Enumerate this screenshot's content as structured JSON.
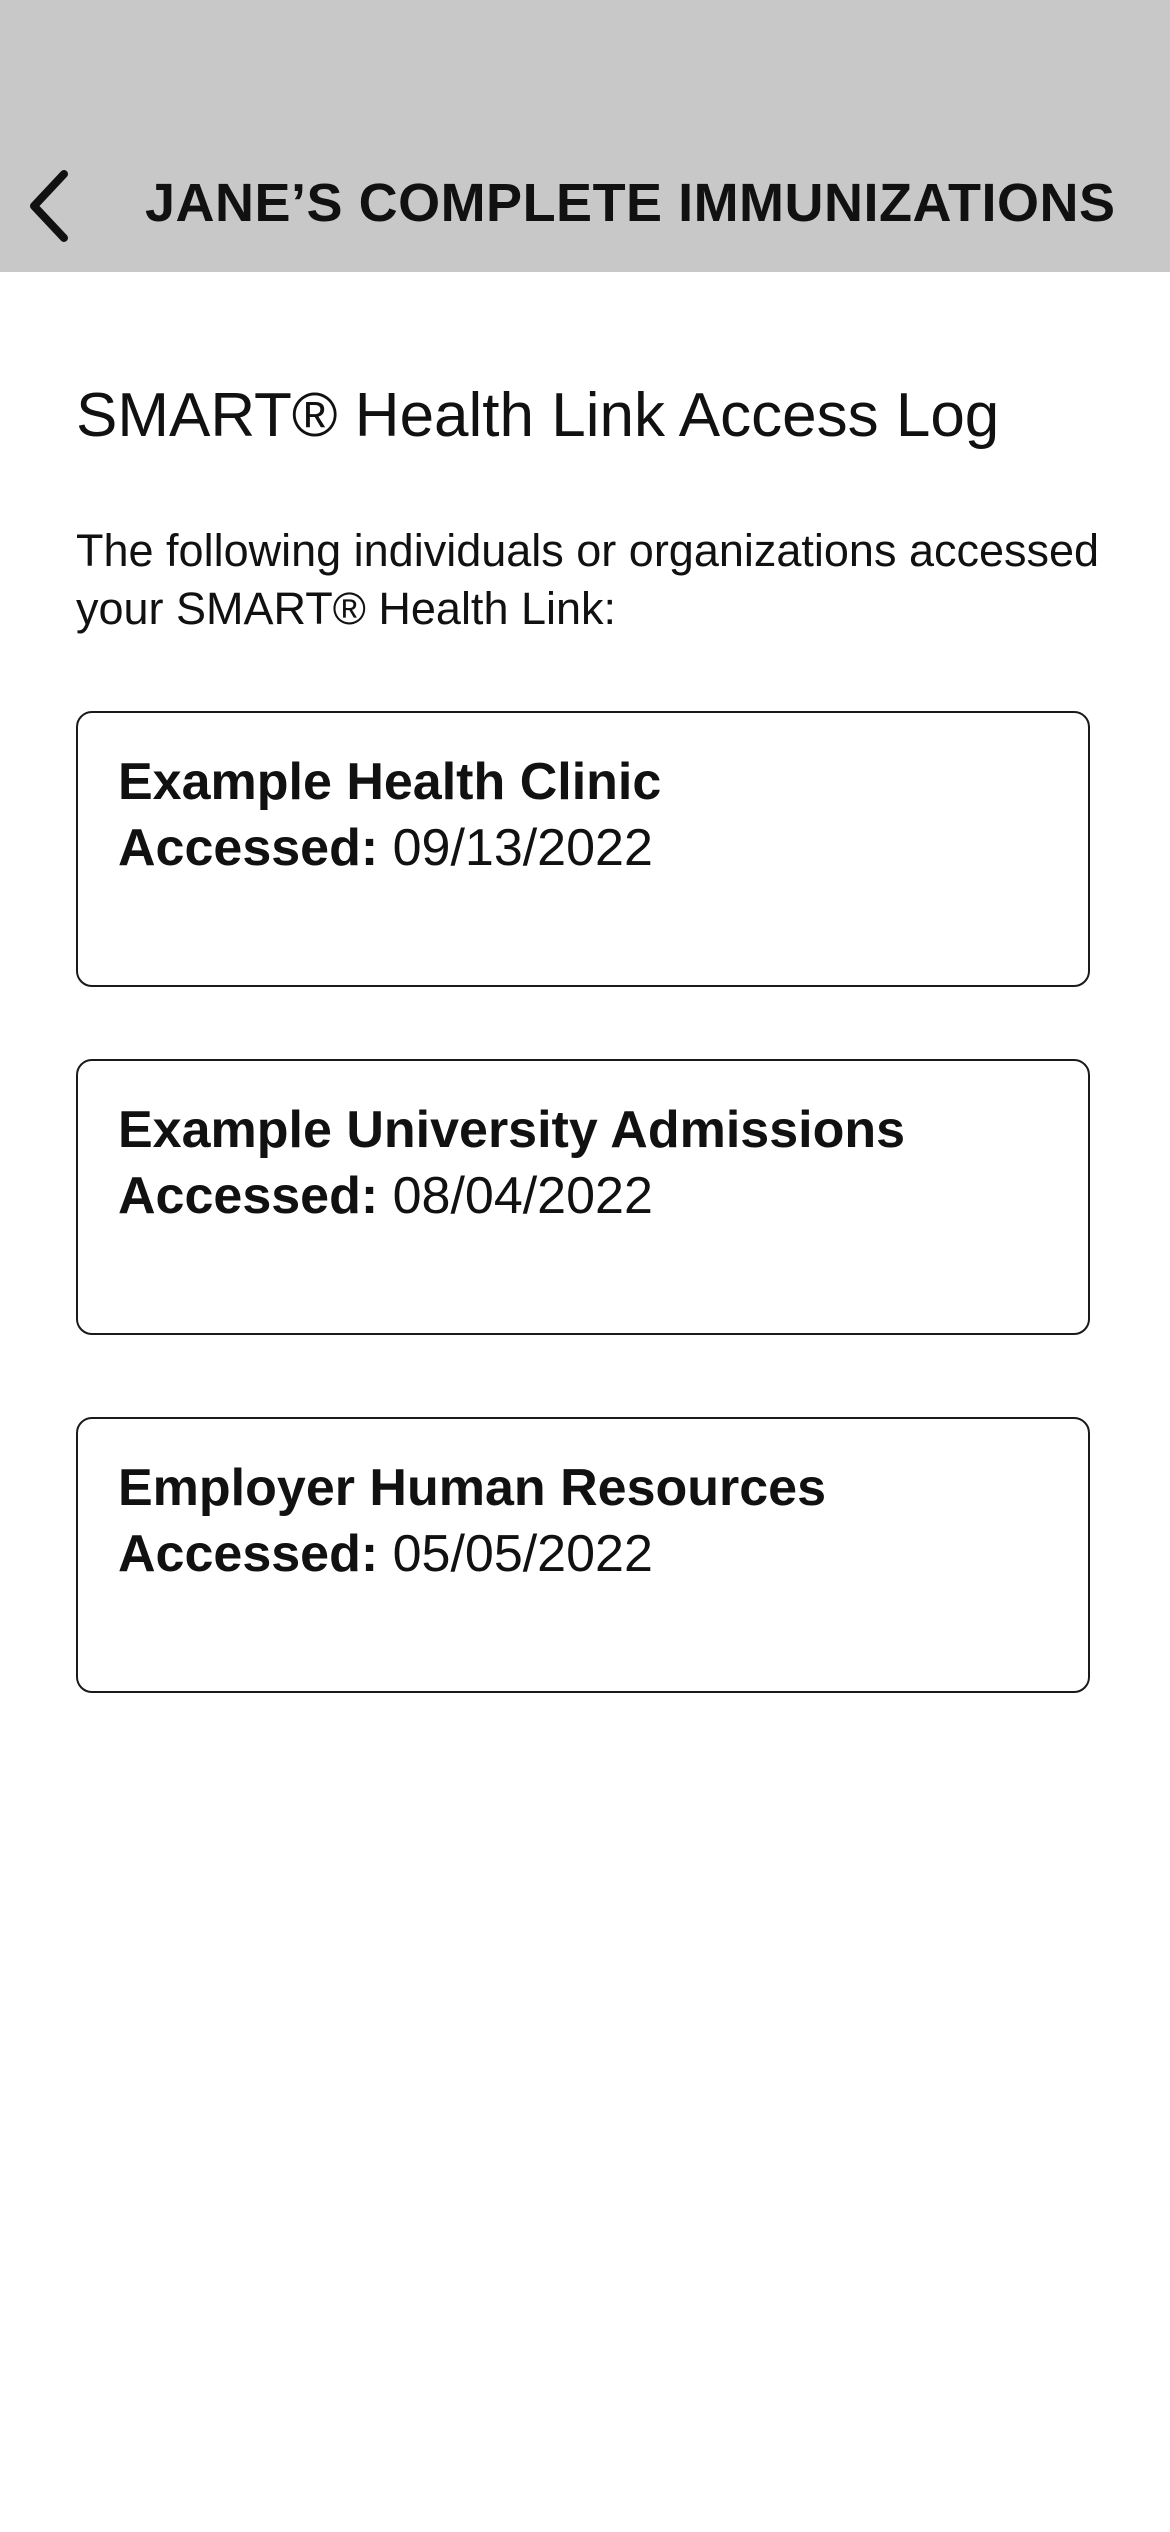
{
  "header": {
    "title": "JANE’S COMPLETE IMMUNIZATIONS",
    "back_icon": "chevron-left-icon"
  },
  "main": {
    "title": "SMART® Health Link Access Log",
    "intro": "The following individuals or organizations accessed your SMART® Health Link:",
    "accessed_label": "Accessed:",
    "entries": [
      {
        "name": "Example Health Clinic",
        "date": "09/13/2022"
      },
      {
        "name": "Example University Admissions",
        "date": "08/04/2022"
      },
      {
        "name": "Employer Human Resources",
        "date": "05/05/2022"
      }
    ]
  }
}
